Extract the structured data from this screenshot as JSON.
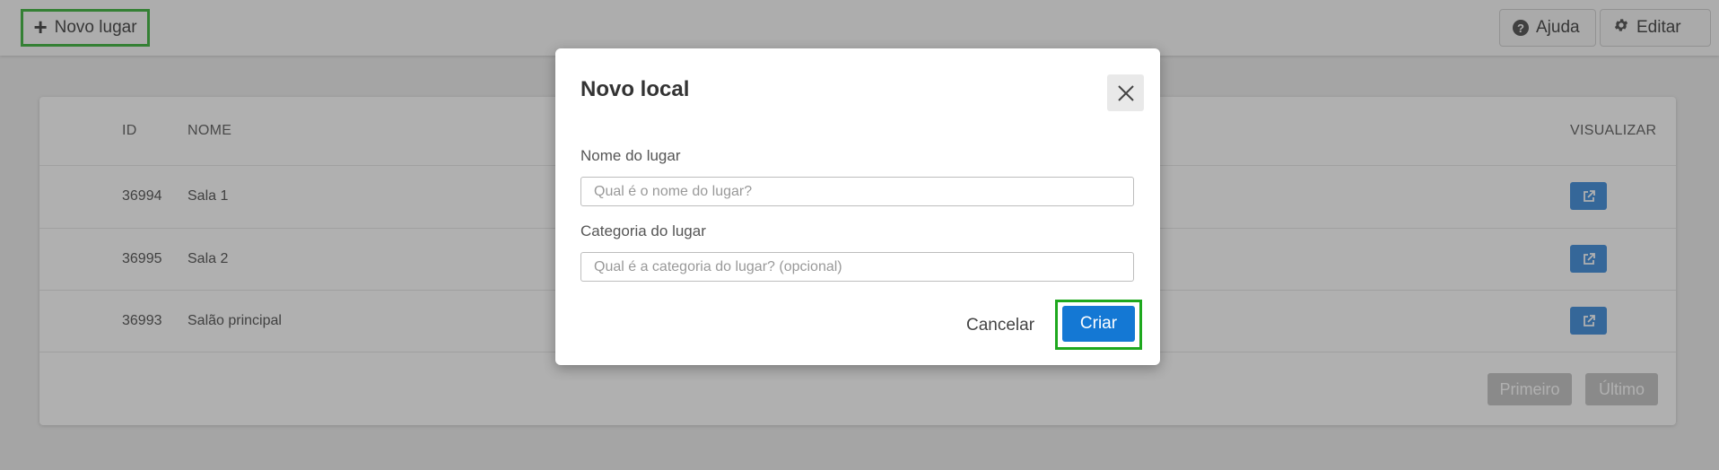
{
  "toolbar": {
    "new_place_label": "Novo lugar",
    "help_label": "Ajuda",
    "edit_label": "Editar"
  },
  "table": {
    "columns": {
      "id": "ID",
      "name": "NOME",
      "view": "VISUALIZAR"
    },
    "rows": [
      {
        "id": "36994",
        "name": "Sala 1"
      },
      {
        "id": "36995",
        "name": "Sala 2"
      },
      {
        "id": "36993",
        "name": "Salão principal"
      }
    ]
  },
  "pagination": {
    "first": "Primeiro",
    "last": "Último"
  },
  "modal": {
    "title": "Novo local",
    "place_name_label": "Nome do lugar",
    "place_name_placeholder": "Qual é o nome do lugar?",
    "place_category_label": "Categoria do lugar",
    "place_category_placeholder": "Qual é a categoria do lugar? (opcional)",
    "cancel_label": "Cancelar",
    "create_label": "Criar"
  },
  "icons": {
    "add": "plus-icon",
    "help": "question-circle-icon",
    "edit": "gear-icon",
    "view": "external-link-icon",
    "close": "close-icon"
  },
  "colors": {
    "primary": "#1478d4",
    "highlight": "#1ea81e",
    "pagination_disabled": "#bbbbbb"
  }
}
